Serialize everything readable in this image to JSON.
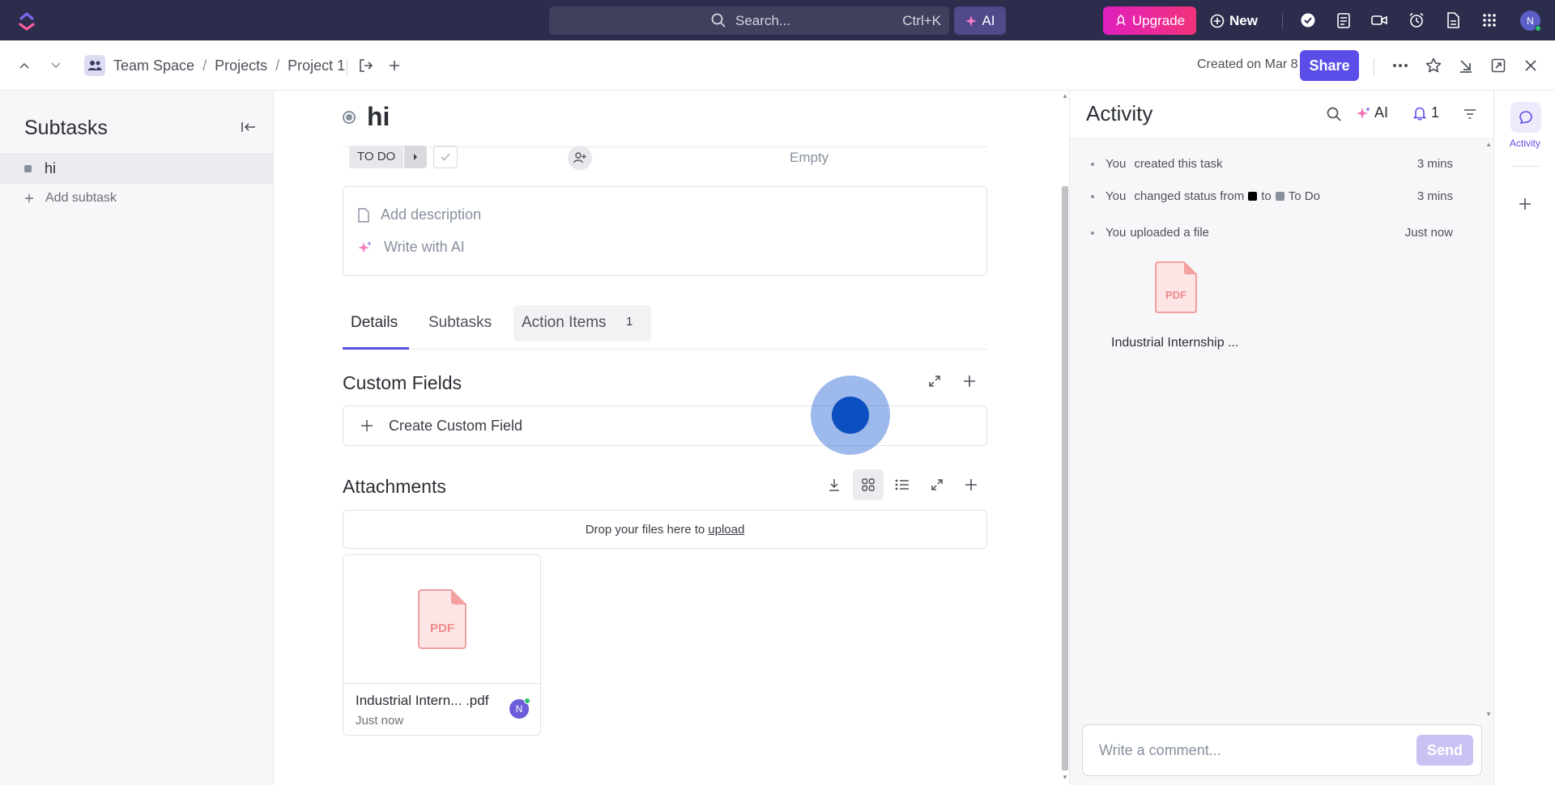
{
  "topbar": {
    "search_placeholder": "Search...",
    "search_shortcut": "Ctrl+K",
    "ai_label": "AI",
    "upgrade_label": "Upgrade",
    "new_label": "New",
    "avatar_initial": "N"
  },
  "header": {
    "breadcrumbs": [
      "Team Space",
      "Projects",
      "Project 1"
    ],
    "crumb_separator": "/",
    "created_text": "Created on Mar 8",
    "share_label": "Share"
  },
  "sidebar": {
    "title": "Subtasks",
    "items": [
      {
        "label": "hi"
      }
    ],
    "add_label": "Add subtask"
  },
  "task": {
    "title": "hi",
    "status": "TO DO",
    "field_value": "Empty",
    "description_placeholder": "Add description",
    "ai_write_label": "Write with AI",
    "tabs": [
      {
        "label": "Details"
      },
      {
        "label": "Subtasks"
      },
      {
        "label": "Action Items"
      }
    ],
    "action_items_count": "1",
    "custom_fields_title": "Custom Fields",
    "create_field_label": "Create Custom Field",
    "attachments_title": "Attachments",
    "drop_text": "Drop your files here to",
    "upload_link": "upload",
    "attachment": {
      "name": "Industrial Intern...  .pdf",
      "time": "Just now",
      "badge": "PDF",
      "avatar_initial": "N"
    }
  },
  "activity": {
    "title": "Activity",
    "ai_label": "AI",
    "notif_count": "1",
    "entries": [
      {
        "actor": "You",
        "text": "created this task",
        "time": "3 mins"
      },
      {
        "actor": "You",
        "text_before": "changed status from",
        "text_mid": "to",
        "text_after": "To Do",
        "time": "3 mins"
      },
      {
        "actor": "You",
        "text": "uploaded a file",
        "time": "Just now"
      }
    ],
    "file_badge": "PDF",
    "file_name": "Industrial Internship ...",
    "comment_placeholder": "Write a comment...",
    "send_label": "Send"
  },
  "rail": {
    "activity_label": "Activity"
  },
  "colors": {
    "topbar": "#2c2c4c",
    "accent": "#5b4ee8",
    "upgrade_start": "#e01fbf",
    "upgrade_end": "#f2337a",
    "status_from": "#000000",
    "status_to": "#87909e"
  }
}
